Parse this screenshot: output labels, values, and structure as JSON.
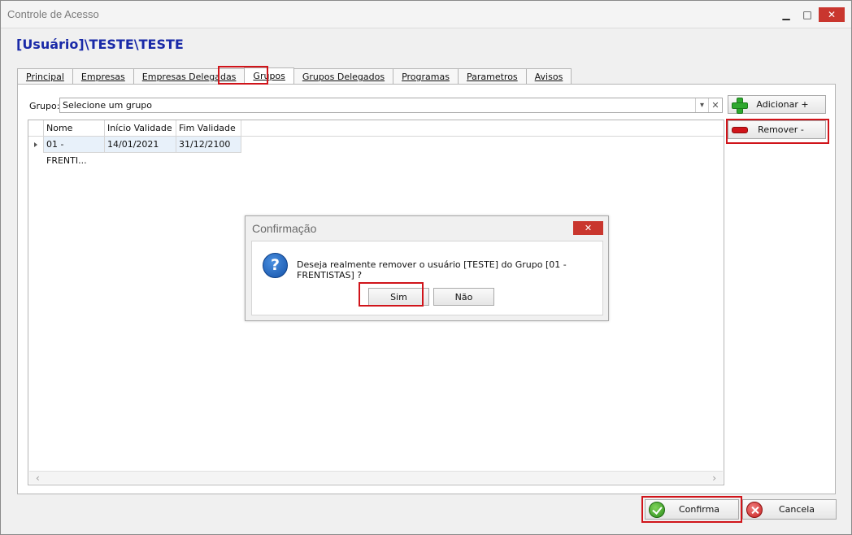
{
  "window": {
    "title": "Controle de Acesso"
  },
  "heading": "[Usuário]\\TESTE\\TESTE",
  "tabs": [
    {
      "label": "Principal"
    },
    {
      "label": "Empresas"
    },
    {
      "label": "Empresas Delegadas"
    },
    {
      "label": "Grupos"
    },
    {
      "label": "Grupos Delegados"
    },
    {
      "label": "Programas"
    },
    {
      "label": "Parametros"
    },
    {
      "label": "Avisos"
    }
  ],
  "active_tab": "Grupos",
  "grupo": {
    "label": "Grupo:",
    "value": "Selecione um grupo"
  },
  "toolbar": {
    "add_label": "Adicionar +",
    "remove_label": "Remover -"
  },
  "grid": {
    "columns": [
      "Nome",
      "Início Validade",
      "Fim Validade"
    ],
    "rows": [
      {
        "nome": "01 - FRENTI...",
        "inicio": "14/01/2021",
        "fim": "31/12/2100"
      }
    ]
  },
  "dialog": {
    "title": "Confirmação",
    "message": "Deseja realmente remover o usuário [TESTE] do Grupo [01 - FRENTISTAS] ?",
    "yes_label": "Sim",
    "no_label": "Não"
  },
  "footer": {
    "confirm_label": "Confirma",
    "cancel_label": "Cancela"
  },
  "colors": {
    "heading": "#1a2aa8",
    "highlight_box": "#d0141a",
    "close_button": "#c9362e",
    "selected_row": "#e8f1fa"
  }
}
